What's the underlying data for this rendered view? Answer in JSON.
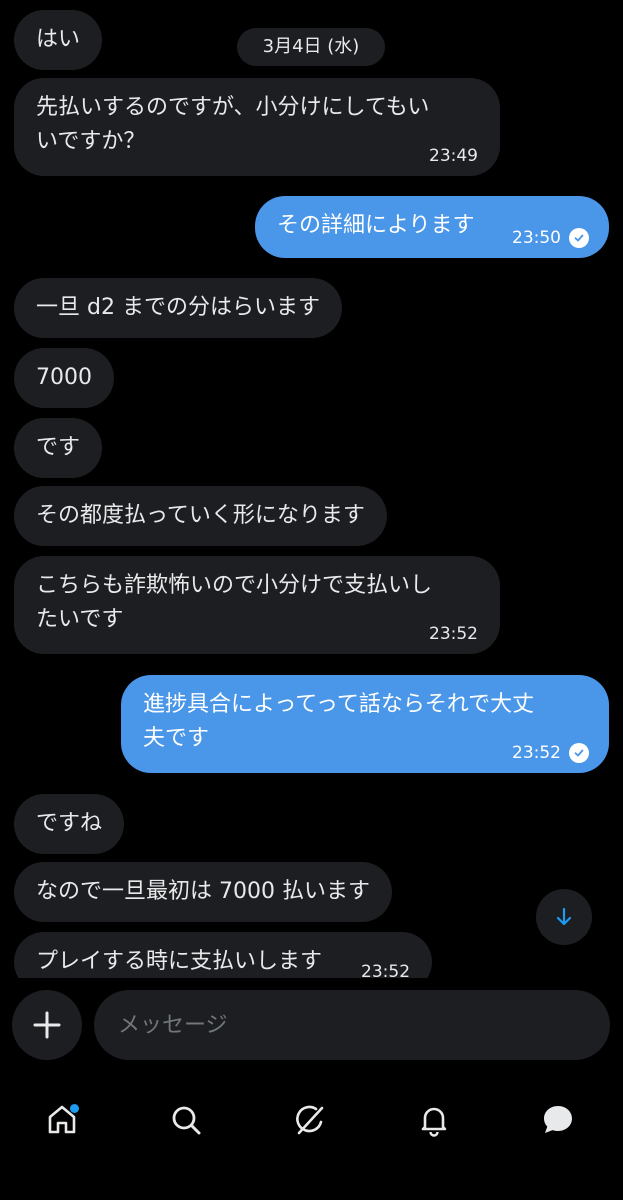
{
  "date_chip": "3月4日 (水)",
  "messages": [
    {
      "text": "はい"
    },
    {
      "text": "先払いするのですが、小分けにしてもい",
      "text2": "いですか？",
      "time": "23:49"
    },
    {
      "text": "その詳細によります",
      "time": "23:50"
    },
    {
      "text": "一旦 d2 までの分はらいます"
    },
    {
      "text": "7000"
    },
    {
      "text": "です"
    },
    {
      "text": "その都度払っていく形になります"
    },
    {
      "text": "こちらも詐欺怖いので小分けで支払いし",
      "text2": "たいです",
      "time": "23:52"
    },
    {
      "text": "進捗具合によってって話ならそれで大丈",
      "text2": "夫です",
      "time": "23:52"
    },
    {
      "text": "ですね"
    },
    {
      "text": "なので一旦最初は 7000 払います"
    },
    {
      "text": "プレイする時に支払いします",
      "time": "23:52"
    }
  ],
  "composer": {
    "placeholder": "メッセージ"
  },
  "colors": {
    "accent": "#1d9bf0",
    "outgoing_bubble": "#4a96e8",
    "incoming_bubble": "#1c1e21",
    "background": "#000000"
  },
  "icons": [
    "plus-icon",
    "arrow-down-icon",
    "home-icon",
    "search-icon",
    "grok-icon",
    "bell-icon",
    "chat-bubble-icon",
    "checkmark-icon"
  ]
}
